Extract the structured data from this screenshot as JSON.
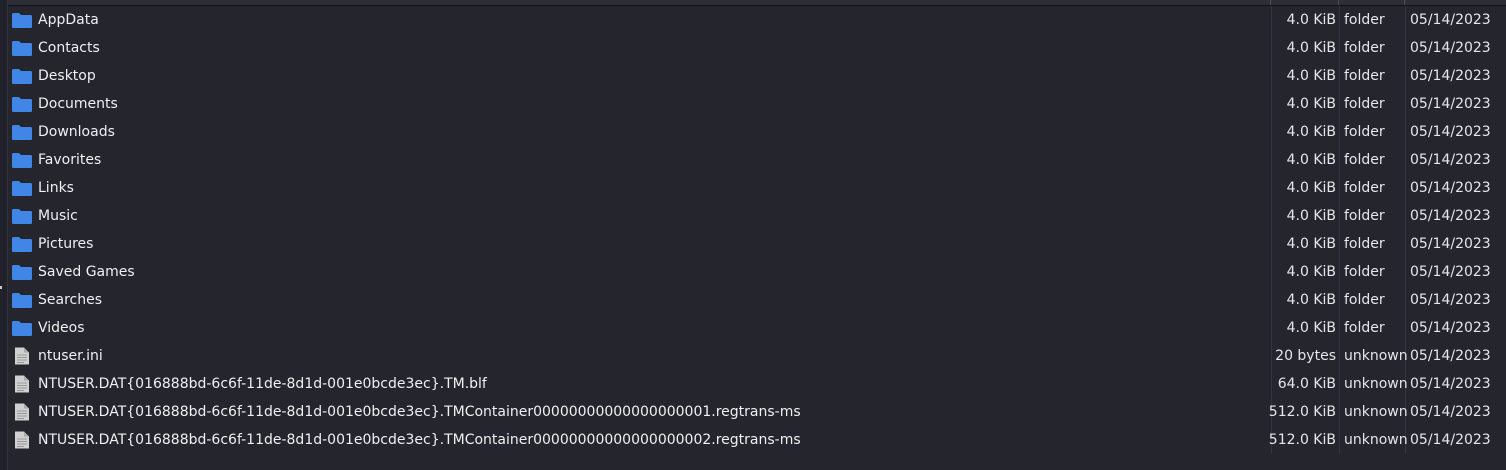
{
  "colors": {
    "background": "#24252d",
    "folder_icon": "#3f86e6",
    "file_icon": "#d0d0d0",
    "text": "#f0f0f2"
  },
  "files": [
    {
      "name": "AppData",
      "size": "4.0 KiB",
      "type": "folder",
      "date": "05/14/2023",
      "icon": "folder-icon"
    },
    {
      "name": "Contacts",
      "size": "4.0 KiB",
      "type": "folder",
      "date": "05/14/2023",
      "icon": "folder-icon"
    },
    {
      "name": "Desktop",
      "size": "4.0 KiB",
      "type": "folder",
      "date": "05/14/2023",
      "icon": "folder-icon"
    },
    {
      "name": "Documents",
      "size": "4.0 KiB",
      "type": "folder",
      "date": "05/14/2023",
      "icon": "folder-icon"
    },
    {
      "name": "Downloads",
      "size": "4.0 KiB",
      "type": "folder",
      "date": "05/14/2023",
      "icon": "folder-icon"
    },
    {
      "name": "Favorites",
      "size": "4.0 KiB",
      "type": "folder",
      "date": "05/14/2023",
      "icon": "folder-icon"
    },
    {
      "name": "Links",
      "size": "4.0 KiB",
      "type": "folder",
      "date": "05/14/2023",
      "icon": "folder-icon"
    },
    {
      "name": "Music",
      "size": "4.0 KiB",
      "type": "folder",
      "date": "05/14/2023",
      "icon": "folder-icon"
    },
    {
      "name": "Pictures",
      "size": "4.0 KiB",
      "type": "folder",
      "date": "05/14/2023",
      "icon": "folder-icon"
    },
    {
      "name": "Saved Games",
      "size": "4.0 KiB",
      "type": "folder",
      "date": "05/14/2023",
      "icon": "folder-icon"
    },
    {
      "name": "Searches",
      "size": "4.0 KiB",
      "type": "folder",
      "date": "05/14/2023",
      "icon": "folder-icon"
    },
    {
      "name": "Videos",
      "size": "4.0 KiB",
      "type": "folder",
      "date": "05/14/2023",
      "icon": "folder-icon"
    },
    {
      "name": "ntuser.ini",
      "size": "20 bytes",
      "type": "unknown",
      "date": "05/14/2023",
      "icon": "file-icon"
    },
    {
      "name": "NTUSER.DAT{016888bd-6c6f-11de-8d1d-001e0bcde3ec}.TM.blf",
      "size": "64.0 KiB",
      "type": "unknown",
      "date": "05/14/2023",
      "icon": "file-icon"
    },
    {
      "name": "NTUSER.DAT{016888bd-6c6f-11de-8d1d-001e0bcde3ec}.TMContainer00000000000000000001.regtrans-ms",
      "size": "512.0 KiB",
      "type": "unknown",
      "date": "05/14/2023",
      "icon": "file-icon"
    },
    {
      "name": "NTUSER.DAT{016888bd-6c6f-11de-8d1d-001e0bcde3ec}.TMContainer00000000000000000002.regtrans-ms",
      "size": "512.0 KiB",
      "type": "unknown",
      "date": "05/14/2023",
      "icon": "file-icon"
    }
  ]
}
